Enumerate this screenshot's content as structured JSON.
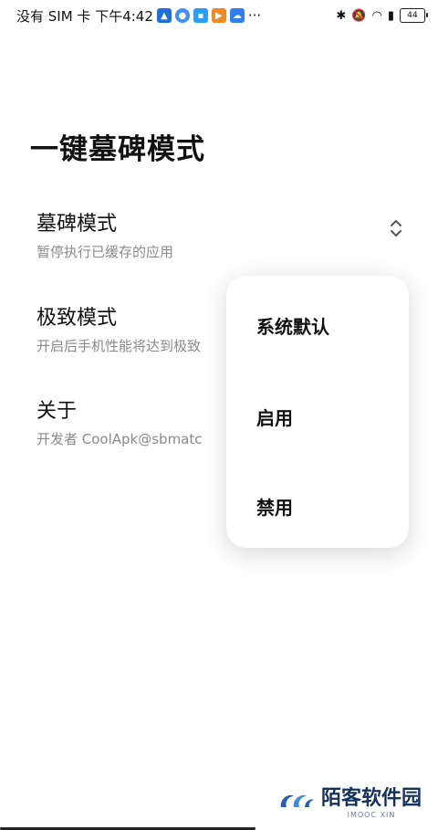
{
  "status_bar": {
    "carrier": "没有 SIM 卡 下午4:42",
    "more": "···",
    "battery": "44"
  },
  "page": {
    "title": "一键墓碑模式"
  },
  "settings": [
    {
      "title": "墓碑模式",
      "desc": "暂停执行已缓存的应用"
    },
    {
      "title": "极致模式",
      "desc": "开启后手机性能将达到极致"
    },
    {
      "title": "关于",
      "desc": "开发者 CoolApk@sbmatc"
    }
  ],
  "dropdown": {
    "options": [
      "系统默认",
      "启用",
      "禁用"
    ]
  },
  "watermark": {
    "text": "陌客软件园",
    "sub": "IMOOC XIN"
  },
  "colors": {
    "accent": "#16325c",
    "desc_gray": "#8a8a8a"
  }
}
